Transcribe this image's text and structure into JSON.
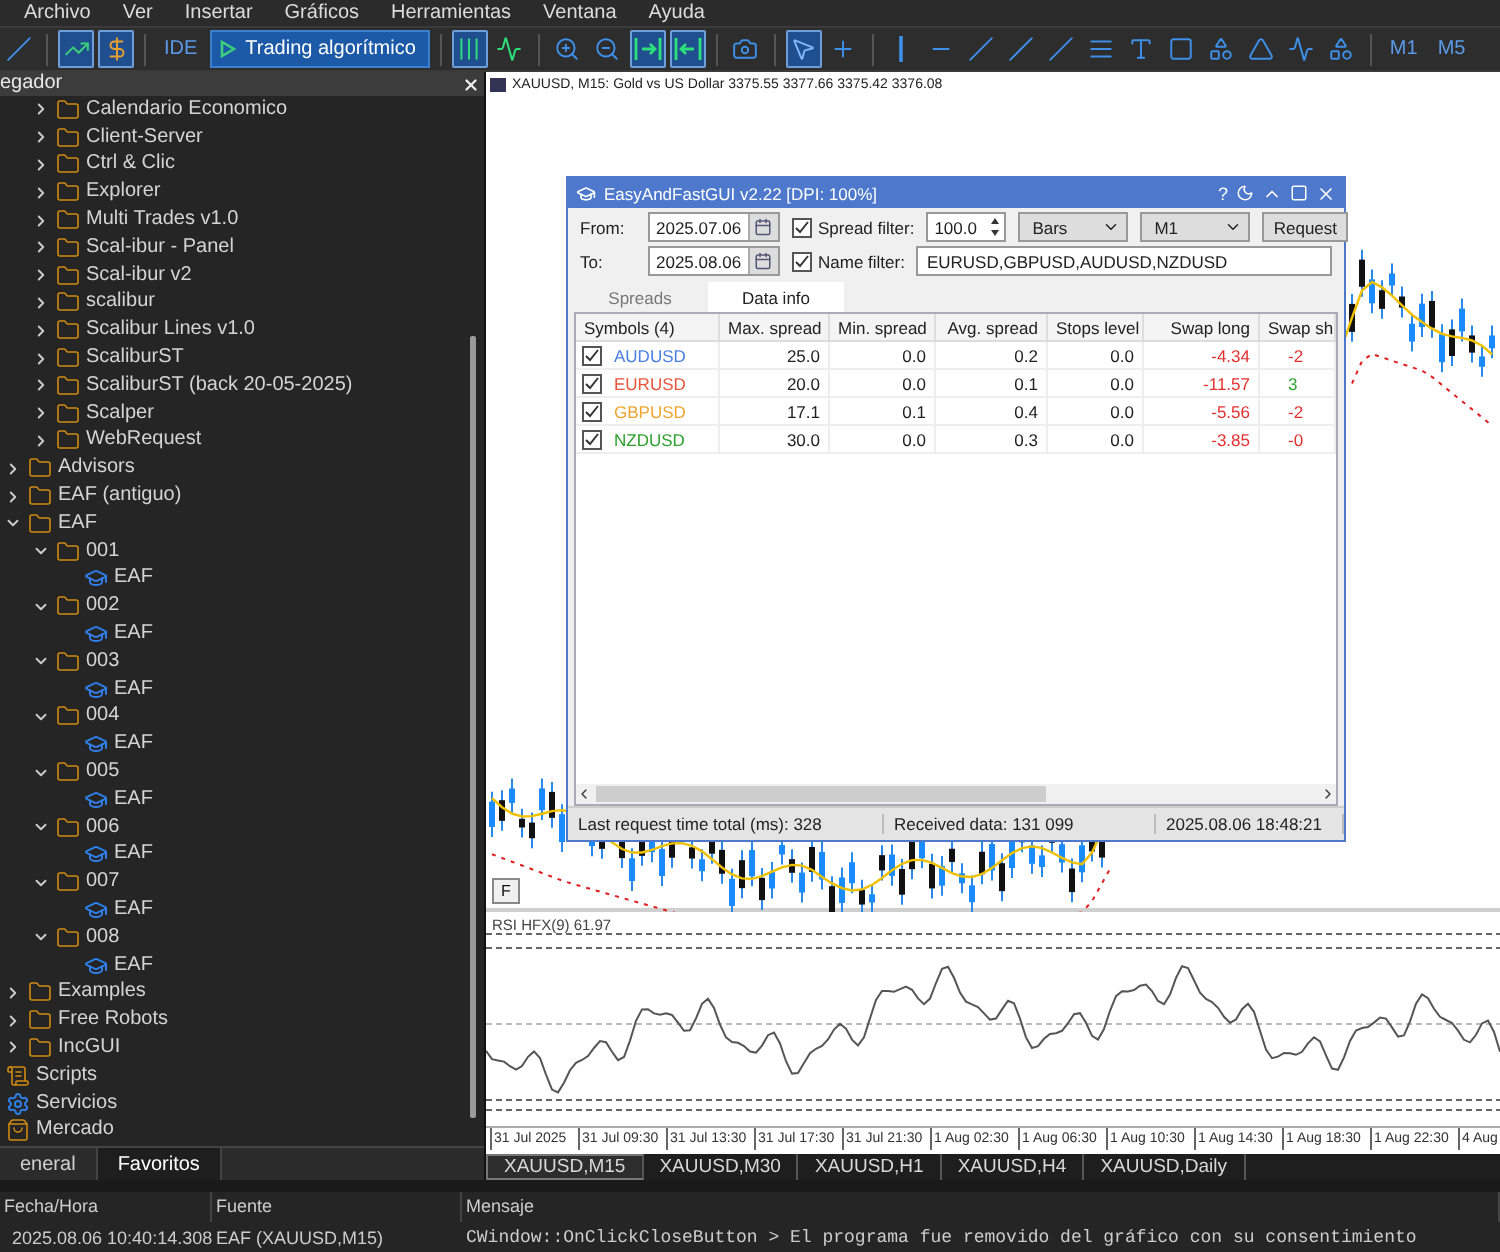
{
  "menu": [
    "Archivo",
    "Ver",
    "Insertar",
    "Gráficos",
    "Herramientas",
    "Ventana",
    "Ayuda"
  ],
  "toolbar": [
    {
      "kind": "icon",
      "selected": false
    },
    {
      "kind": "separator"
    },
    {
      "kind": "icon",
      "selected": true
    },
    {
      "kind": "icon",
      "selected": true
    },
    {
      "kind": "separator"
    },
    {
      "kind": "label",
      "label": "IDE"
    },
    {
      "kind": "action",
      "label": "Trading algorítmico"
    },
    {
      "kind": "separator"
    },
    {
      "kind": "icon",
      "selected": true
    },
    {
      "kind": "icon",
      "selected": false
    },
    {
      "kind": "separator"
    },
    {
      "kind": "icon",
      "selected": false
    },
    {
      "kind": "icon",
      "selected": false
    },
    {
      "kind": "icon",
      "selected": true
    },
    {
      "kind": "icon",
      "selected": true
    },
    {
      "kind": "separator"
    },
    {
      "kind": "icon",
      "selected": false
    },
    {
      "kind": "separator"
    },
    {
      "kind": "icon",
      "selected": true
    },
    {
      "kind": "icon",
      "selected": false
    },
    {
      "kind": "separator"
    },
    {
      "kind": "icon",
      "selected": false
    },
    {
      "kind": "icon",
      "selected": false
    },
    {
      "kind": "icon",
      "selected": false
    },
    {
      "kind": "icon",
      "selected": false
    },
    {
      "kind": "icon",
      "selected": false
    },
    {
      "kind": "icon",
      "selected": false
    },
    {
      "kind": "icon",
      "selected": false
    },
    {
      "kind": "icon",
      "selected": false
    },
    {
      "kind": "icon",
      "selected": false
    },
    {
      "kind": "icon",
      "selected": false
    },
    {
      "kind": "icon",
      "selected": false
    },
    {
      "kind": "icon",
      "selected": false
    },
    {
      "kind": "separator"
    },
    {
      "kind": "label",
      "label": "M1"
    },
    {
      "kind": "label",
      "label": "M5"
    }
  ],
  "navigator": {
    "title": "egador",
    "partial_branch": [
      {
        "label": "Calendario Economico",
        "kind": "folder",
        "expanded": false
      },
      {
        "label": "Client-Server",
        "kind": "folder",
        "expanded": false
      },
      {
        "label": "Ctrl & Clic",
        "kind": "folder",
        "expanded": false
      },
      {
        "label": "Explorer",
        "kind": "folder",
        "expanded": false
      },
      {
        "label": "Multi Trades v1.0",
        "kind": "folder",
        "expanded": false
      },
      {
        "label": "Scal-ibur - Panel",
        "kind": "folder",
        "expanded": false
      },
      {
        "label": "Scal-ibur v2",
        "kind": "folder",
        "expanded": false
      },
      {
        "label": "scalibur",
        "kind": "folder",
        "expanded": false
      },
      {
        "label": "Scalibur Lines v1.0",
        "kind": "folder",
        "expanded": false
      },
      {
        "label": "ScaliburST",
        "kind": "folder",
        "expanded": false
      },
      {
        "label": "ScaliburST (back 20-05-2025)",
        "kind": "folder",
        "expanded": false
      },
      {
        "label": "Scalper",
        "kind": "folder",
        "expanded": false
      },
      {
        "label": "WebRequest",
        "kind": "folder",
        "expanded": false
      }
    ],
    "tree": [
      {
        "label": "Advisors",
        "kind": "folder",
        "expanded": false
      },
      {
        "label": "EAF (antiguo)",
        "kind": "folder",
        "expanded": false
      },
      {
        "label": "EAF",
        "kind": "folder",
        "expanded": true,
        "children": [
          {
            "label": "001",
            "kind": "folder",
            "expanded": true,
            "children": [
              {
                "label": "EAF",
                "kind": "expert"
              }
            ]
          },
          {
            "label": "002",
            "kind": "folder",
            "expanded": true,
            "children": [
              {
                "label": "EAF",
                "kind": "expert"
              }
            ]
          },
          {
            "label": "003",
            "kind": "folder",
            "expanded": true,
            "children": [
              {
                "label": "EAF",
                "kind": "expert"
              }
            ]
          },
          {
            "label": "004",
            "kind": "folder",
            "expanded": true,
            "children": [
              {
                "label": "EAF",
                "kind": "expert"
              }
            ]
          },
          {
            "label": "005",
            "kind": "folder",
            "expanded": true,
            "children": [
              {
                "label": "EAF",
                "kind": "expert"
              }
            ]
          },
          {
            "label": "006",
            "kind": "folder",
            "expanded": true,
            "children": [
              {
                "label": "EAF",
                "kind": "expert"
              }
            ]
          },
          {
            "label": "007",
            "kind": "folder",
            "expanded": true,
            "children": [
              {
                "label": "EAF",
                "kind": "expert"
              }
            ]
          },
          {
            "label": "008",
            "kind": "folder",
            "expanded": true,
            "children": [
              {
                "label": "EAF",
                "kind": "expert"
              }
            ]
          }
        ]
      },
      {
        "label": "Examples",
        "kind": "folder",
        "expanded": false
      },
      {
        "label": "Free Robots",
        "kind": "folder",
        "expanded": false
      },
      {
        "label": "IncGUI",
        "kind": "folder",
        "expanded": false
      }
    ],
    "sections": [
      {
        "label": "Scripts",
        "kind": "scripts"
      },
      {
        "label": "Servicios",
        "kind": "services"
      },
      {
        "label": "Mercado",
        "kind": "market"
      }
    ],
    "tabs": [
      {
        "label": "eneral",
        "selected": false
      },
      {
        "label": "Favoritos",
        "selected": true
      }
    ]
  },
  "chart": {
    "header": "XAUUSD, M15:  Gold vs US Dollar  3375.55 3377.66 3375.42 3376.08",
    "f_button": "F",
    "indicator": "RSI HFX(9) 61.97",
    "time_labels": [
      "31 Jul 2025",
      "31 Jul 09:30",
      "31 Jul 13:30",
      "31 Jul 17:30",
      "31 Jul 21:30",
      "1 Aug 02:30",
      "1 Aug 06:30",
      "1 Aug 10:30",
      "1 Aug 14:30",
      "1 Aug 18:30",
      "1 Aug 22:30",
      "4 Aug"
    ],
    "tabs": [
      {
        "label": "XAUUSD,M15",
        "selected": true
      },
      {
        "label": "XAUUSD,M30",
        "selected": false
      },
      {
        "label": "XAUUSD,H1",
        "selected": false
      },
      {
        "label": "XAUUSD,H4",
        "selected": false
      },
      {
        "label": "XAUUSD,Daily",
        "selected": false
      }
    ]
  },
  "dialog": {
    "title": "EasyAndFastGUI v2.22 [DPI: 100%]",
    "title_buttons": [
      "?"
    ],
    "from_label": "From:",
    "from_value": "2025.07.06",
    "to_label": "To:",
    "to_value": "2025.08.06",
    "spread_filter": {
      "label": "Spread filter:",
      "checked": true,
      "value": "100.0"
    },
    "name_filter": {
      "label": "Name filter:",
      "checked": true,
      "value": "EURUSD,GBPUSD,AUDUSD,NZDUSD"
    },
    "mode": "Bars",
    "timeframe": "M1",
    "request": "Request",
    "tabs": [
      {
        "label": "Spreads",
        "selected": false
      },
      {
        "label": "Data info",
        "selected": true
      }
    ],
    "columns": [
      "Symbols (4)",
      "Max. spread",
      "Min. spread",
      "Avg. spread",
      "Stops level",
      "Swap long",
      "Swap sh"
    ],
    "rows": [
      {
        "checked": true,
        "symbol": "AUDUSD",
        "color": "#4a7fe0",
        "max": "25.0",
        "min": "0.0",
        "avg": "0.2",
        "stops": "0.0",
        "swap_long": {
          "text": "-4.34",
          "color": "#e53030"
        },
        "swap_short": {
          "text": "-2",
          "color": "#e53030"
        }
      },
      {
        "checked": true,
        "symbol": "EURUSD",
        "color": "#e8553a",
        "max": "20.0",
        "min": "0.0",
        "avg": "0.1",
        "stops": "0.0",
        "swap_long": {
          "text": "-11.57",
          "color": "#e53030"
        },
        "swap_short": {
          "text": "3",
          "color": "#2ea02e"
        }
      },
      {
        "checked": true,
        "symbol": "GBPUSD",
        "color": "#f0a530",
        "max": "17.1",
        "min": "0.1",
        "avg": "0.4",
        "stops": "0.0",
        "swap_long": {
          "text": "-5.56",
          "color": "#e53030"
        },
        "swap_short": {
          "text": "-2",
          "color": "#e53030"
        }
      },
      {
        "checked": true,
        "symbol": "NZDUSD",
        "color": "#2ea02e",
        "max": "30.0",
        "min": "0.0",
        "avg": "0.3",
        "stops": "0.0",
        "swap_long": {
          "text": "-3.85",
          "color": "#e53030"
        },
        "swap_short": {
          "text": "-0",
          "color": "#e53030"
        }
      }
    ],
    "status": [
      "Last request time total (ms): 328",
      "Received data: 131 099",
      "2025.08.06 18:48:21"
    ]
  },
  "journal": {
    "columns": [
      "Fecha/Hora",
      "Fuente",
      "Mensaje"
    ],
    "rows": [
      {
        "time": "2025.08.06 10:40:14.308",
        "source": "EAF (XAUUSD,M15)",
        "message": "CWindow::OnClickCloseButton > El programa fue removido del gráfico con su consentimiento"
      }
    ]
  }
}
